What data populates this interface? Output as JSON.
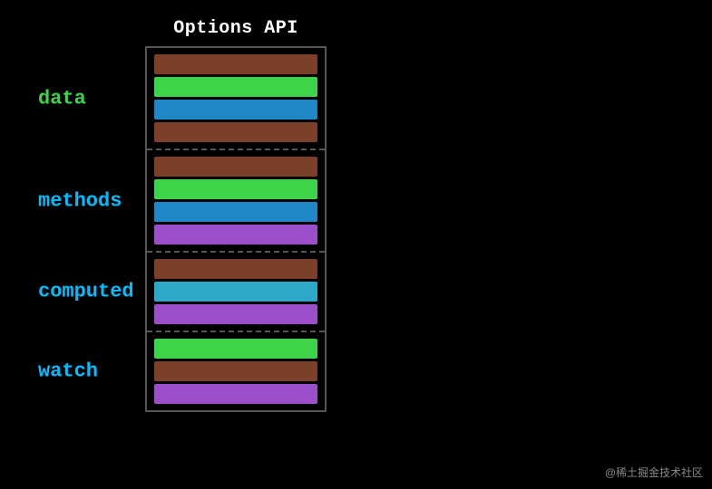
{
  "title": "Options API",
  "sections": [
    {
      "label": "data",
      "label_color": "green",
      "bars": [
        "brown",
        "green",
        "blue",
        "brown"
      ]
    },
    {
      "label": "methods",
      "label_color": "cyan",
      "bars": [
        "brown",
        "green",
        "blue",
        "purple"
      ]
    },
    {
      "label": "computed",
      "label_color": "cyan",
      "bars": [
        "brown",
        "cyan",
        "purple"
      ]
    },
    {
      "label": "watch",
      "label_color": "cyan",
      "bars": [
        "green",
        "brown",
        "purple"
      ]
    }
  ],
  "watermark": "@稀土掘金技术社区"
}
